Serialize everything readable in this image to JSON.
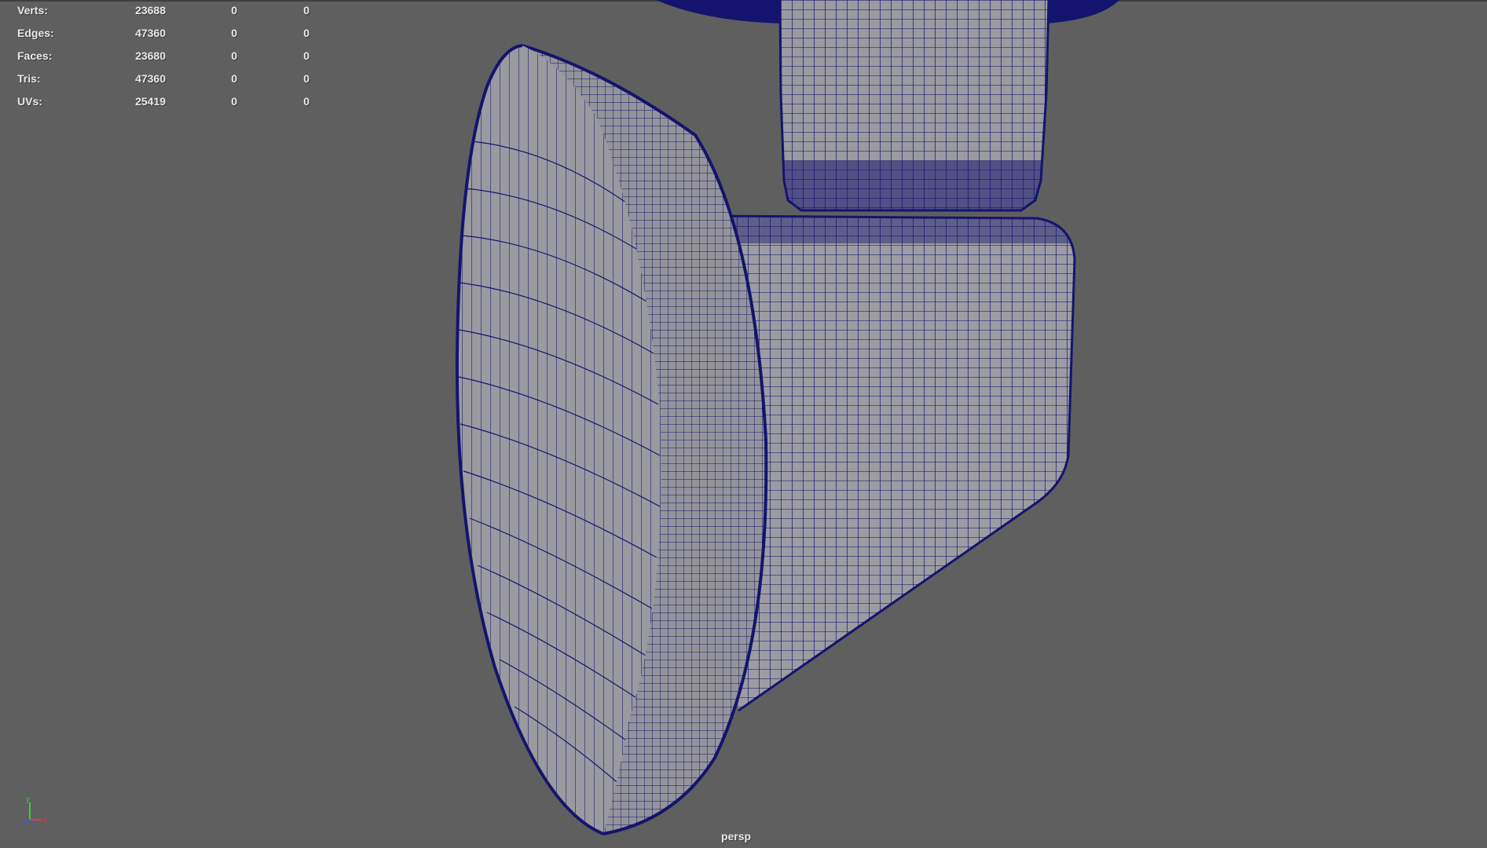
{
  "hud": {
    "stats": [
      {
        "label": "Verts:",
        "v1": "23688",
        "v2": "0",
        "v3": "0"
      },
      {
        "label": "Edges:",
        "v1": "47360",
        "v2": "0",
        "v3": "0"
      },
      {
        "label": "Faces:",
        "v1": "23680",
        "v2": "0",
        "v3": "0"
      },
      {
        "label": "Tris:",
        "v1": "47360",
        "v2": "0",
        "v3": "0"
      },
      {
        "label": "UVs:",
        "v1": "25419",
        "v2": "0",
        "v3": "0"
      }
    ]
  },
  "viewport": {
    "camera_name": "persp",
    "background_color": "#5f5f5f",
    "wire_color": "#14146e",
    "shade_color": "#9a9a9e"
  },
  "axis_gizmo": {
    "y_label": "y",
    "x_label": "x",
    "z_label": "z",
    "y_color": "#3ad13a",
    "x_color": "#e03a3a",
    "z_color": "#3a5ae0"
  }
}
